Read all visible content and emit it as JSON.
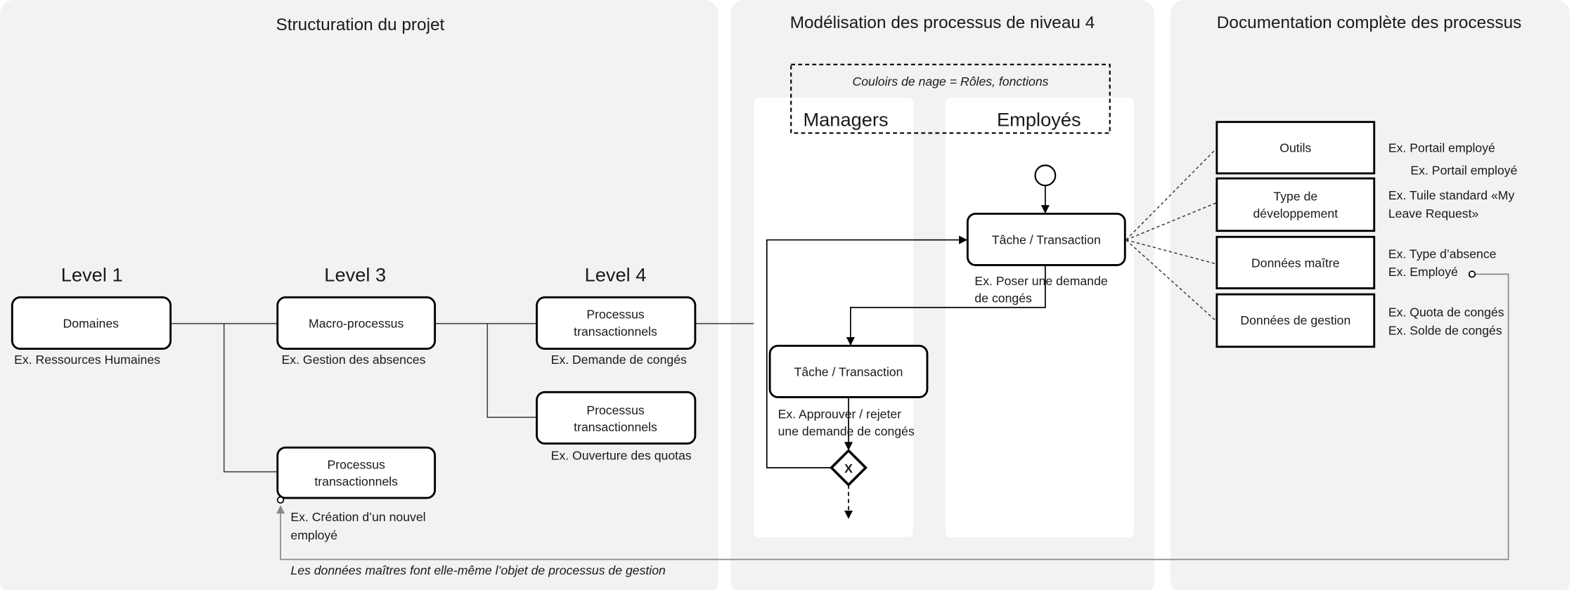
{
  "sections": {
    "structuration": {
      "title": "Structuration du projet",
      "levels": [
        "Level 1",
        "Level 3",
        "Level 4"
      ],
      "boxes": {
        "domaines": "Domaines",
        "macro": "Macro-processus",
        "proc_a": [
          "Processus",
          "transactionnels"
        ],
        "proc_b": [
          "Processus",
          "transactionnels"
        ],
        "proc_c": [
          "Processus",
          "transactionnels"
        ]
      },
      "captions": {
        "domaines": "Ex. Ressources Humaines",
        "macro": "Ex. Gestion des absences",
        "proc_a": "Ex. Demande de congés",
        "proc_b": "Ex. Ouverture des quotas",
        "proc_c": [
          "Ex. Création d’un nouvel",
          "employé"
        ]
      },
      "footnote": "Les données maîtres font elle-même l’objet de processus de gestion"
    },
    "modelisation": {
      "title": "Modélisation des processus de niveau 4",
      "swimlane_note": "Couloirs de nage = Rôles, fonctions",
      "lanes": [
        "Managers",
        "Employés"
      ],
      "task_employee": "Tâche / Transaction",
      "task_employee_caption": [
        "Ex. Poser une demande",
        "de congés"
      ],
      "task_manager": "Tâche / Transaction",
      "task_manager_caption": [
        "Ex. Approuver / rejeter",
        "une demande de congés"
      ],
      "gateway_label": "X"
    },
    "documentation": {
      "title": "Documentation complète des processus",
      "items": [
        {
          "label": [
            "Outils"
          ],
          "examples": [
            "Ex. Portail employé",
            "Ex. Portail employé"
          ]
        },
        {
          "label": [
            "Type de",
            "développement"
          ],
          "examples": [
            "Ex. Tuile standard «My",
            "Leave Request»"
          ]
        },
        {
          "label": [
            "Données maître"
          ],
          "examples": [
            "Ex. Type d’absence",
            "Ex. Employé"
          ]
        },
        {
          "label": [
            "Données de gestion"
          ],
          "examples": [
            "Ex. Quota de congés",
            "Ex. Solde de congés"
          ]
        }
      ]
    }
  },
  "colors": {
    "panel": "#f2f2f2",
    "lane": "#ffffff",
    "feedback_line": "#8a8a8a"
  }
}
